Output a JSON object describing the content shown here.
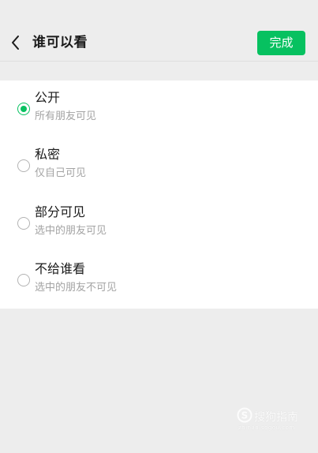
{
  "header": {
    "title": "谁可以看",
    "back_icon": "chevron-left-icon",
    "done_label": "完成"
  },
  "options": [
    {
      "label": "公开",
      "desc": "所有朋友可见",
      "selected": true
    },
    {
      "label": "私密",
      "desc": "仅自己可见",
      "selected": false
    },
    {
      "label": "部分可见",
      "desc": "选中的朋友可见",
      "selected": false
    },
    {
      "label": "不给谁看",
      "desc": "选中的朋友不可见",
      "selected": false
    }
  ],
  "watermark": {
    "text": "搜狗指南",
    "sub": "zhinan.sogou.com"
  },
  "colors": {
    "accent": "#07c160",
    "background": "#ededed",
    "panel": "#ffffff",
    "primary_text": "#1a1a1a",
    "secondary_text": "#a3a3a3"
  }
}
